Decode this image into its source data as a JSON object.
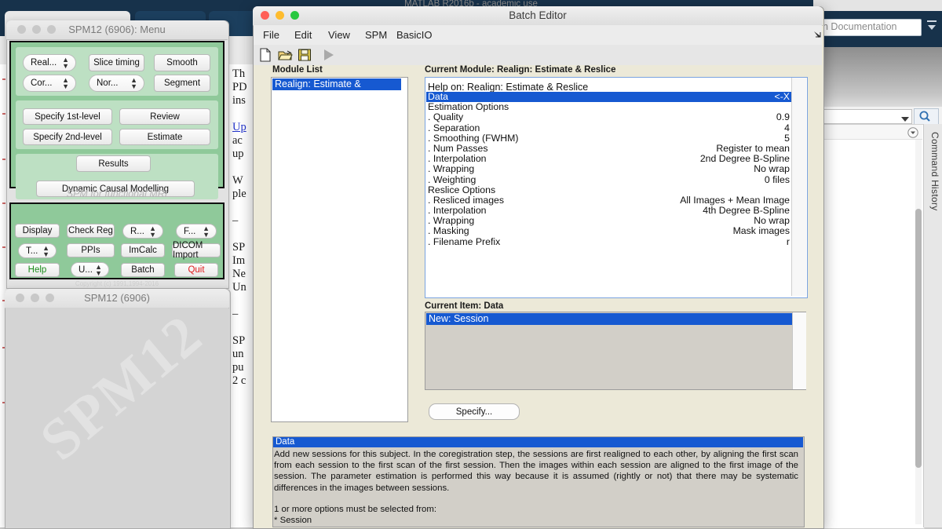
{
  "desktop": {
    "matlab_title": "MATLAB R2016b - academic use",
    "search_documentation_placeholder": "h Documentation",
    "command_history_label": "Command History"
  },
  "background_document": {
    "lines": [
      {
        "text": "Th",
        "link": false
      },
      {
        "text": "PD",
        "link": false
      },
      {
        "text": "ins",
        "link": false
      },
      {
        "text": "",
        "link": false
      },
      {
        "text": "Up",
        "link": true
      },
      {
        "text": "ac",
        "link": false
      },
      {
        "text": "up",
        "link": false
      },
      {
        "text": "",
        "link": false
      },
      {
        "text": "W",
        "link": false
      },
      {
        "text": "ple",
        "link": false
      },
      {
        "text": "",
        "link": false
      },
      {
        "text": "–",
        "link": false
      },
      {
        "text": "",
        "link": false
      },
      {
        "text": "SP",
        "link": false
      },
      {
        "text": "Im",
        "link": false
      },
      {
        "text": "Ne",
        "link": false
      },
      {
        "text": "Un",
        "link": false
      },
      {
        "text": "",
        "link": false
      },
      {
        "text": "–",
        "link": false
      },
      {
        "text": "",
        "link": false
      },
      {
        "text": "SP",
        "link": false
      },
      {
        "text": "un",
        "link": false
      },
      {
        "text": "pu",
        "link": false
      },
      {
        "text": "2 c",
        "link": false
      }
    ]
  },
  "spm_menu": {
    "title": "SPM12 (6906): Menu",
    "footer_label": "SPM for functional MRI",
    "copyright": "Copyright (c) 1991,1994-2016",
    "group1": [
      {
        "label": "Real...",
        "type": "popup"
      },
      {
        "label": "Slice timing",
        "type": "button"
      },
      {
        "label": "Smooth",
        "type": "button"
      },
      {
        "label": "Cor...",
        "type": "popup"
      },
      {
        "label": "Nor...",
        "type": "popup"
      },
      {
        "label": "Segment",
        "type": "button"
      }
    ],
    "group2": [
      {
        "label": "Specify 1st-level",
        "type": "button"
      },
      {
        "label": "Review",
        "type": "button"
      },
      {
        "label": "Specify 2nd-level",
        "type": "button"
      },
      {
        "label": "Estimate",
        "type": "button"
      }
    ],
    "group3": [
      {
        "label": "Results",
        "type": "button"
      }
    ],
    "group4": [
      {
        "label": "Dynamic Causal Modelling",
        "type": "button"
      }
    ],
    "utility_rows": [
      {
        "label": "Display",
        "type": "button",
        "color": "#111111"
      },
      {
        "label": "Check Reg",
        "type": "button",
        "color": "#111111"
      },
      {
        "label": "R...",
        "type": "popup",
        "color": "#111111"
      },
      {
        "label": "F...",
        "type": "popup",
        "color": "#111111"
      },
      {
        "label": "T...",
        "type": "popup",
        "color": "#111111"
      },
      {
        "label": "PPIs",
        "type": "button",
        "color": "#111111"
      },
      {
        "label": "ImCalc",
        "type": "button",
        "color": "#111111"
      },
      {
        "label": "DICOM Import",
        "type": "button",
        "color": "#111111"
      },
      {
        "label": "Help",
        "type": "button",
        "color": "#1a8c1a"
      },
      {
        "label": "U...",
        "type": "popup",
        "color": "#111111"
      },
      {
        "label": "Batch",
        "type": "button",
        "color": "#111111"
      },
      {
        "label": "Quit",
        "type": "button",
        "color": "#e01b1b"
      }
    ]
  },
  "spm_graphics": {
    "title": "SPM12 (6906)",
    "watermark": "SPM12"
  },
  "batch_editor": {
    "title": "Batch Editor",
    "menus": [
      "File",
      "Edit",
      "View",
      "SPM",
      "BasicIO"
    ],
    "toolbar": [
      {
        "name": "new-icon",
        "tooltip": "New"
      },
      {
        "name": "open-icon",
        "tooltip": "Open"
      },
      {
        "name": "save-icon",
        "tooltip": "Save"
      },
      {
        "name": "run-icon",
        "tooltip": "Run"
      }
    ],
    "module_list_label": "Module List",
    "module_list_items": [
      "Realign: Estimate & Reslice<-X"
    ],
    "current_module_label": "Current Module: Realign: Estimate & Reslice",
    "help_title": "Help on: Realign: Estimate & Reslice",
    "options": [
      {
        "key": "Data",
        "value": "<-X",
        "selected": true,
        "indent": 0
      },
      {
        "key": "Estimation Options",
        "value": "",
        "selected": false,
        "indent": 0
      },
      {
        "key": ". Quality",
        "value": "0.9",
        "selected": false,
        "indent": 0
      },
      {
        "key": ". Separation",
        "value": "4",
        "selected": false,
        "indent": 0
      },
      {
        "key": ". Smoothing (FWHM)",
        "value": "5",
        "selected": false,
        "indent": 0
      },
      {
        "key": ". Num Passes",
        "value": "Register to mean",
        "selected": false,
        "indent": 0
      },
      {
        "key": ". Interpolation",
        "value": "2nd Degree B-Spline",
        "selected": false,
        "indent": 0
      },
      {
        "key": ". Wrapping",
        "value": "No wrap",
        "selected": false,
        "indent": 0
      },
      {
        "key": ". Weighting",
        "value": "0 files",
        "selected": false,
        "indent": 0
      },
      {
        "key": "Reslice Options",
        "value": "",
        "selected": false,
        "indent": 0
      },
      {
        "key": ". Resliced images",
        "value": "All Images + Mean Image",
        "selected": false,
        "indent": 0
      },
      {
        "key": ". Interpolation",
        "value": "4th Degree B-Spline",
        "selected": false,
        "indent": 0
      },
      {
        "key": ". Wrapping",
        "value": "No wrap",
        "selected": false,
        "indent": 0
      },
      {
        "key": ". Masking",
        "value": "Mask images",
        "selected": false,
        "indent": 0
      },
      {
        "key": ". Filename Prefix",
        "value": "r",
        "selected": false,
        "indent": 0
      }
    ],
    "current_item_label": "Current Item: Data",
    "current_item_options": [
      "New: Session"
    ],
    "specify_button": "Specify...",
    "bottom_help_title": "Data",
    "bottom_help_paragraph": "Add  new sessions for this subject. In the coregistration step, the sessions are first realigned to each other, by aligning the first scan from each session to the first scan of the first session. Then the images within each session are aligned to the first image of the session. The parameter estimation is performed this way because it is assumed (rightly or not) that there may be systematic differences in the images between sessions.",
    "bottom_help_requirement": "1 or more options must be selected from:",
    "bottom_help_item": "* Session"
  },
  "colors": {
    "selection_blue": "#1659d1",
    "spm_green": "#8fc99a",
    "spm_green_light": "#bde0c3",
    "batch_bg": "#ece9d8",
    "matlab_navy": "#17324b",
    "help_green": "#1a8c1a",
    "quit_red": "#e01b1b"
  }
}
